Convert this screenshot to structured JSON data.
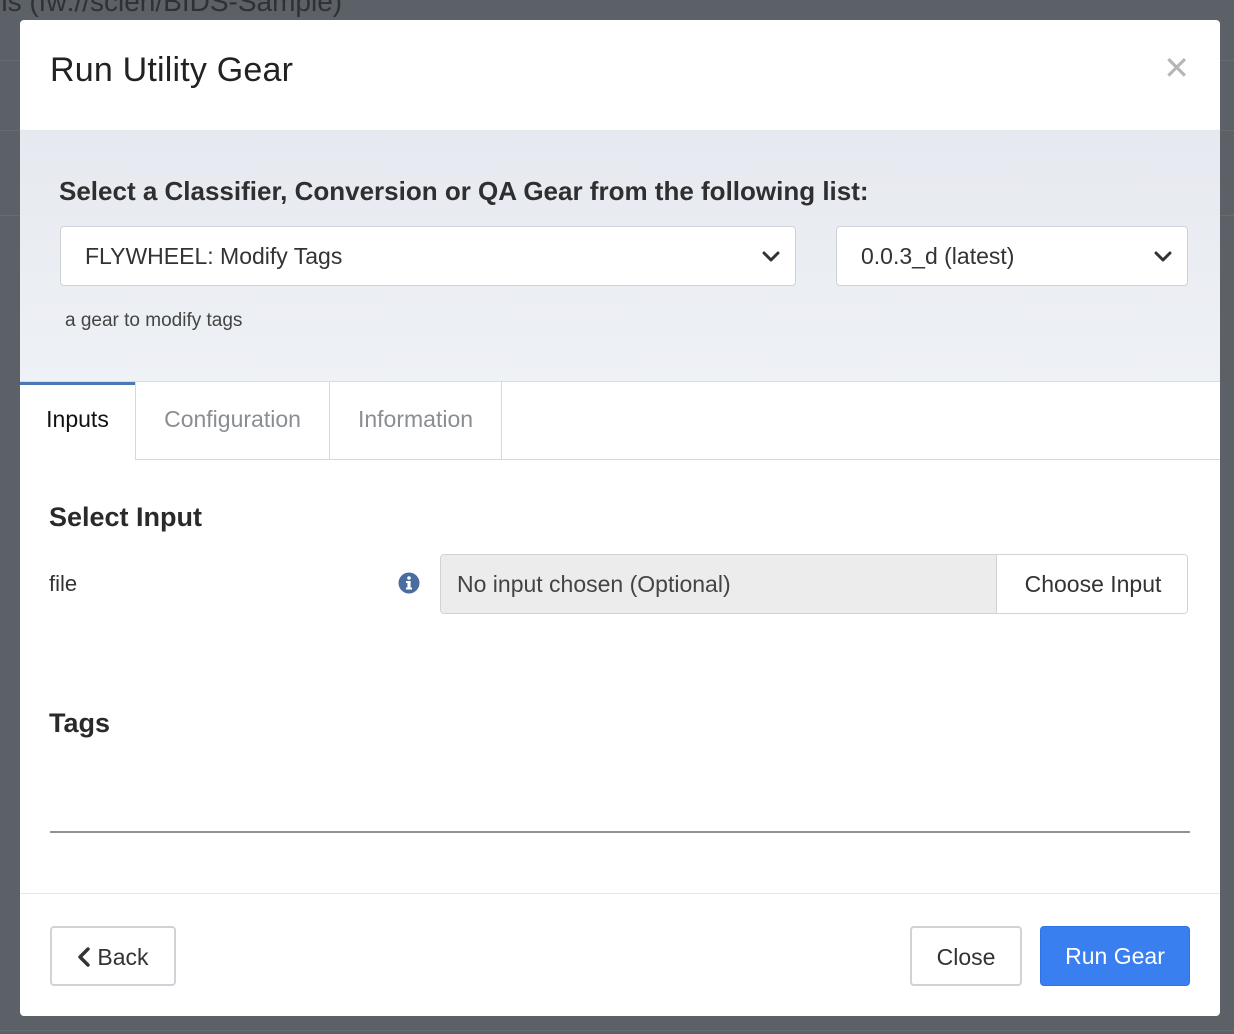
{
  "background": {
    "title": "ns (fw://scien/BIDS-Sample)"
  },
  "modal": {
    "title": "Run Utility Gear",
    "close_icon": "close-icon"
  },
  "gear_selector": {
    "heading": "Select a Classifier, Conversion or QA Gear from the following list:",
    "selected_gear": "FLYWHEEL: Modify Tags",
    "selected_version": "0.0.3_d (latest)",
    "description": "a gear to modify tags"
  },
  "tabs": [
    {
      "label": "Inputs",
      "active": true
    },
    {
      "label": "Configuration",
      "active": false
    },
    {
      "label": "Information",
      "active": false
    }
  ],
  "inputs": {
    "section_title": "Select Input",
    "fields": [
      {
        "label": "file",
        "info_icon": "info-circle-icon",
        "value": "No input chosen (Optional)",
        "button_label": "Choose Input"
      }
    ]
  },
  "tags": {
    "section_title": "Tags"
  },
  "footer": {
    "back_label": "Back",
    "close_label": "Close",
    "run_label": "Run Gear"
  },
  "colors": {
    "primary": "#3a7ff0",
    "tab_active_border": "#4a7ab6",
    "info_icon": "#4b6c9e"
  }
}
